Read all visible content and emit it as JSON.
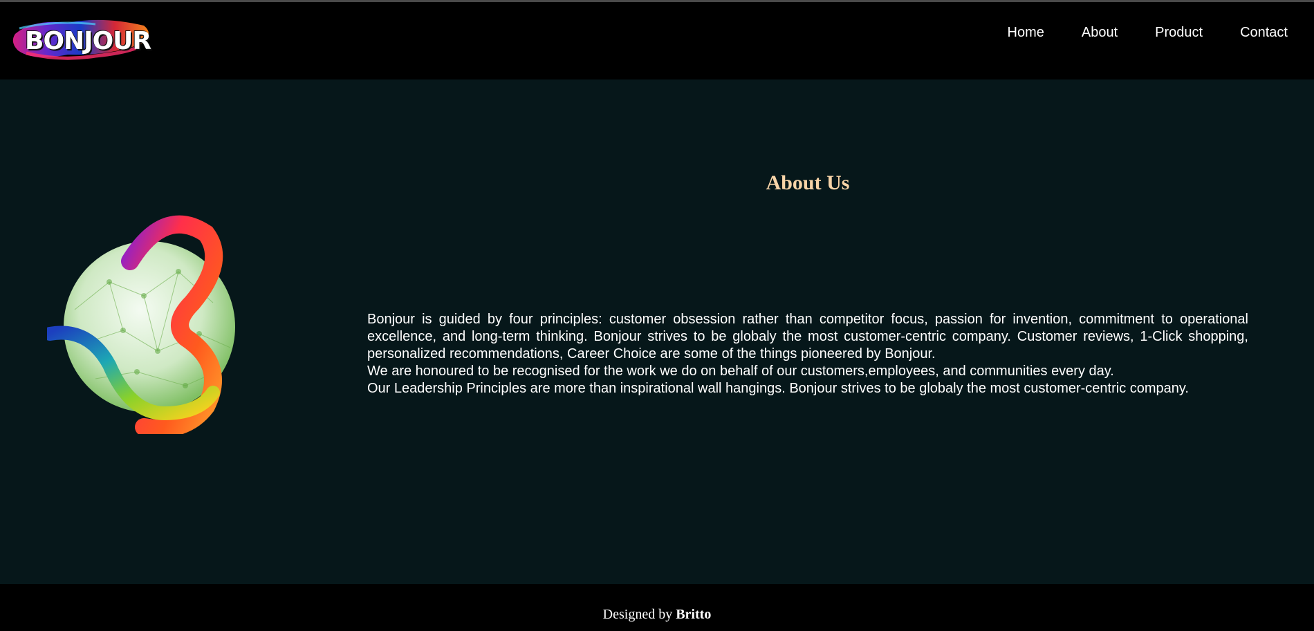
{
  "header": {
    "logo_text": "BONJOUR",
    "nav": [
      {
        "label": "Home"
      },
      {
        "label": "About"
      },
      {
        "label": "Product"
      },
      {
        "label": "Contact"
      }
    ]
  },
  "about": {
    "title": "About Us",
    "paragraphs": [
      "Bonjour is guided by four principles: customer obsession rather than competitor focus, passion for invention, commitment to operational excellence, and long-term thinking. Bonjour strives to be globaly the most customer-centric company. Customer reviews, 1-Click shopping, personalized recommendations, Career Choice are some of the things pioneered by Bonjour.",
      "We are honoured to be recognised for the work we do on behalf of our customers,employees, and communities every day.",
      "Our Leadership Principles are more than inspirational wall hangings. Bonjour strives to be globaly the most customer-centric company."
    ]
  },
  "footer": {
    "prefix": "Designed by",
    "author": "Britto"
  },
  "colors": {
    "header_bg": "#000000",
    "main_bg": "#06171a",
    "title_color": "#f7d4a8",
    "text_color": "#ffffff"
  }
}
